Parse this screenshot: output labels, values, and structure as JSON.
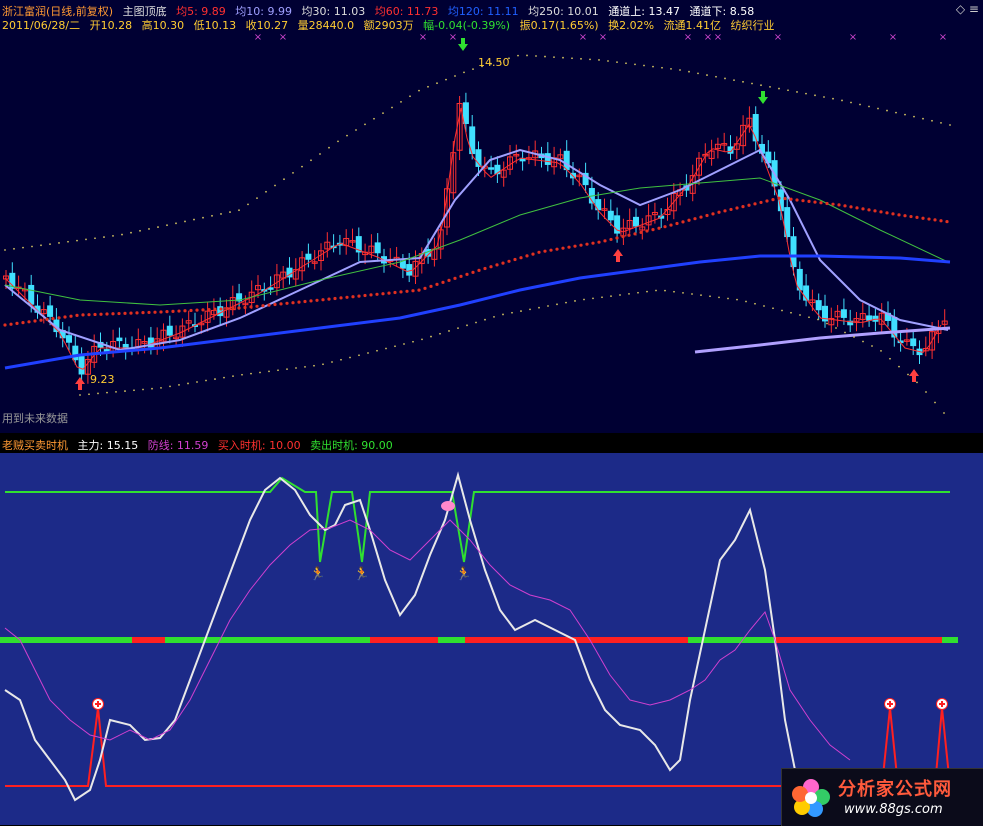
{
  "header": {
    "stock": "浙江富润(日线,前复权)",
    "main_chart": "主图顶底",
    "ma5": "均5: 9.89",
    "ma10": "均10: 9.99",
    "ma30": "均30: 11.03",
    "ma60": "均60: 11.73",
    "ma120": "均120: 11.11",
    "ma250": "均250: 10.01",
    "channel_up": "通道上: 13.47",
    "channel_down": "通道下: 8.58",
    "corner_mark": "◇ ≡",
    "date": "2011/06/28/二",
    "open": "开10.28",
    "high": "高10.30",
    "low": "低10.13",
    "close": "收10.27",
    "volume": "量28440.0",
    "amount": "额2903万",
    "change": "幅-0.04(-0.39%)",
    "amplitude": "振0.17(1.65%)",
    "turnover": "换2.02%",
    "float_cap": "流通1.41亿",
    "industry": "纺织行业"
  },
  "annotations": {
    "high_label": "14.50",
    "low_label": "9.23",
    "future_note": "用到未来数据"
  },
  "indicator": {
    "name": "老贼买卖时机",
    "main_force": "主力: 15.15",
    "defense": "防线: 11.59",
    "buy_timing": "买入时机: 10.00",
    "sell_timing": "卖出时机: 90.00"
  },
  "watermark": {
    "title": "分析家公式网",
    "url": "www.88gs.com"
  },
  "colors": {
    "main_bg": "#000033",
    "indicator_bg": "#1c2a88",
    "up_candle": "#ff3030",
    "down_candle": "#40e0ff",
    "ma5": "#ff3030",
    "ma10": "#a0a0ff",
    "ma30": "#40c040",
    "ma120": "#e03020",
    "ma250": "#2040ff",
    "main_force_line": "#e8e8e8",
    "defense_line": "#d040d0",
    "signal_green": "#30e030",
    "signal_red": "#ff2020"
  }
}
